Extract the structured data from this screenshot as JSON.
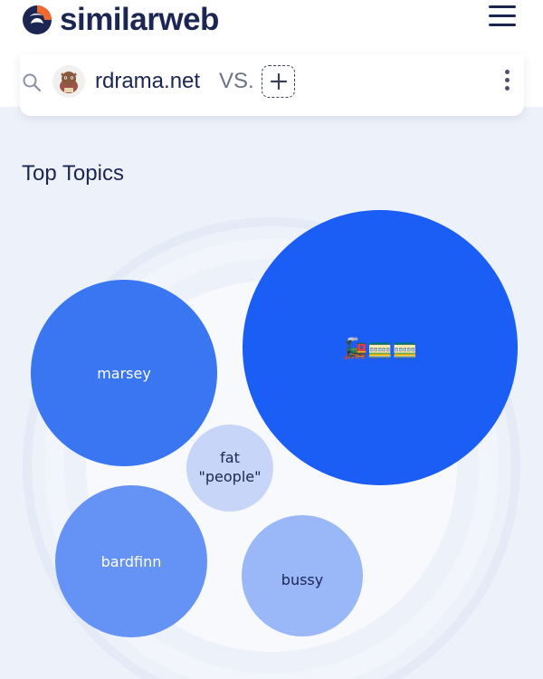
{
  "header": {
    "brand": "similarweb",
    "logo_icon": "similarweb-logo-icon",
    "menu_icon": "hamburger-menu-icon"
  },
  "compare": {
    "search_icon": "search-icon",
    "site_name": "rdrama.net",
    "vs_label": "VS.",
    "add_icon": "plus-icon",
    "more_icon": "kebab-menu-icon"
  },
  "topics": {
    "title": "Top Topics"
  },
  "chart_data": {
    "type": "bubble",
    "title": "Top Topics",
    "bubbles": [
      {
        "label": "🚂🚃🚃",
        "rank": 1,
        "color": "#1a5ef5"
      },
      {
        "label": "marsey",
        "rank": 2,
        "color": "#3b76f2"
      },
      {
        "label": "bardfinn",
        "rank": 3,
        "color": "#6593f5"
      },
      {
        "label": "bussy",
        "rank": 4,
        "color": "#9ab7f8"
      },
      {
        "label": "fat \"people\"",
        "rank": 5,
        "color": "#c6d5f8"
      }
    ]
  },
  "colors": {
    "brand_dark": "#1b2653",
    "logo_orange": "#f26a2e",
    "bubble_primary": "#1a5ef5"
  }
}
